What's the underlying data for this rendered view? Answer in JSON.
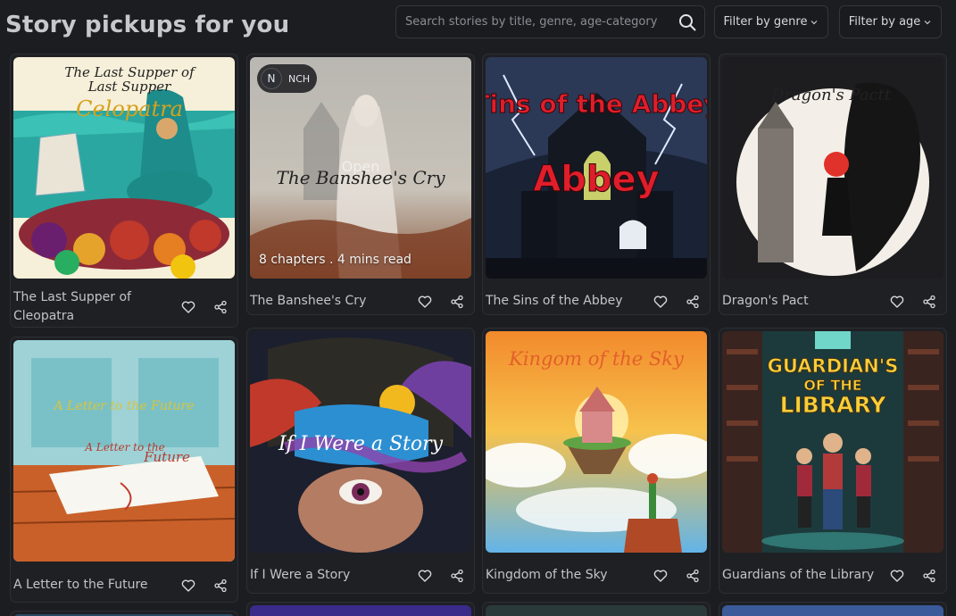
{
  "header": {
    "title": "Story pickups for you",
    "search_placeholder": "Search stories by title, genre, age-category",
    "filter_genre_label": "Filter by genre",
    "filter_age_label": "Filter by age"
  },
  "hover_overlay": {
    "avatar_initial": "N",
    "author": "NCH",
    "open_label": "Open",
    "meta": "8 chapters . 4 mins read"
  },
  "stories": [
    {
      "title": "The Last Supper of Cleopatra",
      "cover_text": [
        "The Last Supper of",
        "Last Supper",
        "Celopatra"
      ]
    },
    {
      "title": "The Banshee's Cry",
      "cover_text": [
        "The Banshee's Cry"
      ]
    },
    {
      "title": "The Sins of the Abbey",
      "cover_text": [
        "Tins of the Abbey",
        "Abbey"
      ]
    },
    {
      "title": "Dragon's Pact",
      "cover_text": [
        "Dragon's Pactt"
      ]
    },
    {
      "title": "A Letter to the Future",
      "cover_text": [
        "A Letter to the Future",
        "A Letter to the",
        "Future"
      ]
    },
    {
      "title": "If I Were a Story",
      "cover_text": [
        "If I Were a Story"
      ]
    },
    {
      "title": "Kingdom of the Sky",
      "cover_text": [
        "Kingom of the Sky"
      ]
    },
    {
      "title": "Guardians of the Library",
      "cover_text": [
        "GUARDIAN'S",
        "OF THE",
        "LIBRARY"
      ]
    }
  ],
  "icons": {
    "search": "search-icon",
    "chevron": "chevron-down-icon",
    "like": "heart-icon",
    "share": "share-icon"
  },
  "colors": {
    "background": "#1c1d21",
    "card": "#1f2024",
    "text": "#c2c4ca"
  }
}
